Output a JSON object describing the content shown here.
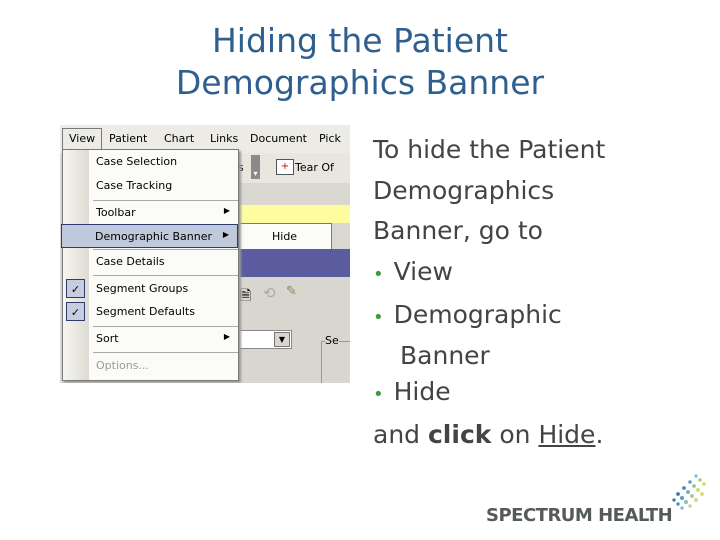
{
  "slide": {
    "title_line1": "Hiding the Patient",
    "title_line2": "Demographics Banner"
  },
  "screenshot": {
    "menubar": [
      "View",
      "Patient",
      "Chart",
      "Links",
      "Document",
      "Pick"
    ],
    "toolbar": {
      "partial_text": "s",
      "tear_off": "Tear Of"
    },
    "submenu": {
      "hide": "Hide"
    },
    "view_menu": [
      {
        "label": "Case Selection"
      },
      {
        "label": "Case Tracking"
      },
      {
        "label": "Toolbar",
        "arrow": "▶"
      },
      {
        "label": "Demographic Banner",
        "arrow": "▶",
        "selected": true
      },
      {
        "label": "Case Details"
      },
      {
        "label": "Segment Groups",
        "checked": true,
        "check": "✓"
      },
      {
        "label": "Segment Defaults",
        "checked": true,
        "check": "✓"
      },
      {
        "label": "Sort",
        "arrow": "▶"
      },
      {
        "label": "Options...",
        "disabled": true
      }
    ],
    "groupbox_label": "Se"
  },
  "instructions": {
    "intro": "To hide the Patient Demographics Banner, go to",
    "bullet": "•",
    "steps": [
      "View",
      "Demographic",
      "Banner",
      "Hide"
    ],
    "outro_pre": "and ",
    "outro_bold": "click",
    "outro_mid": " on ",
    "outro_link": "Hide",
    "outro_end": "."
  },
  "logo": {
    "text": "SPECTRUM HEALTH"
  }
}
